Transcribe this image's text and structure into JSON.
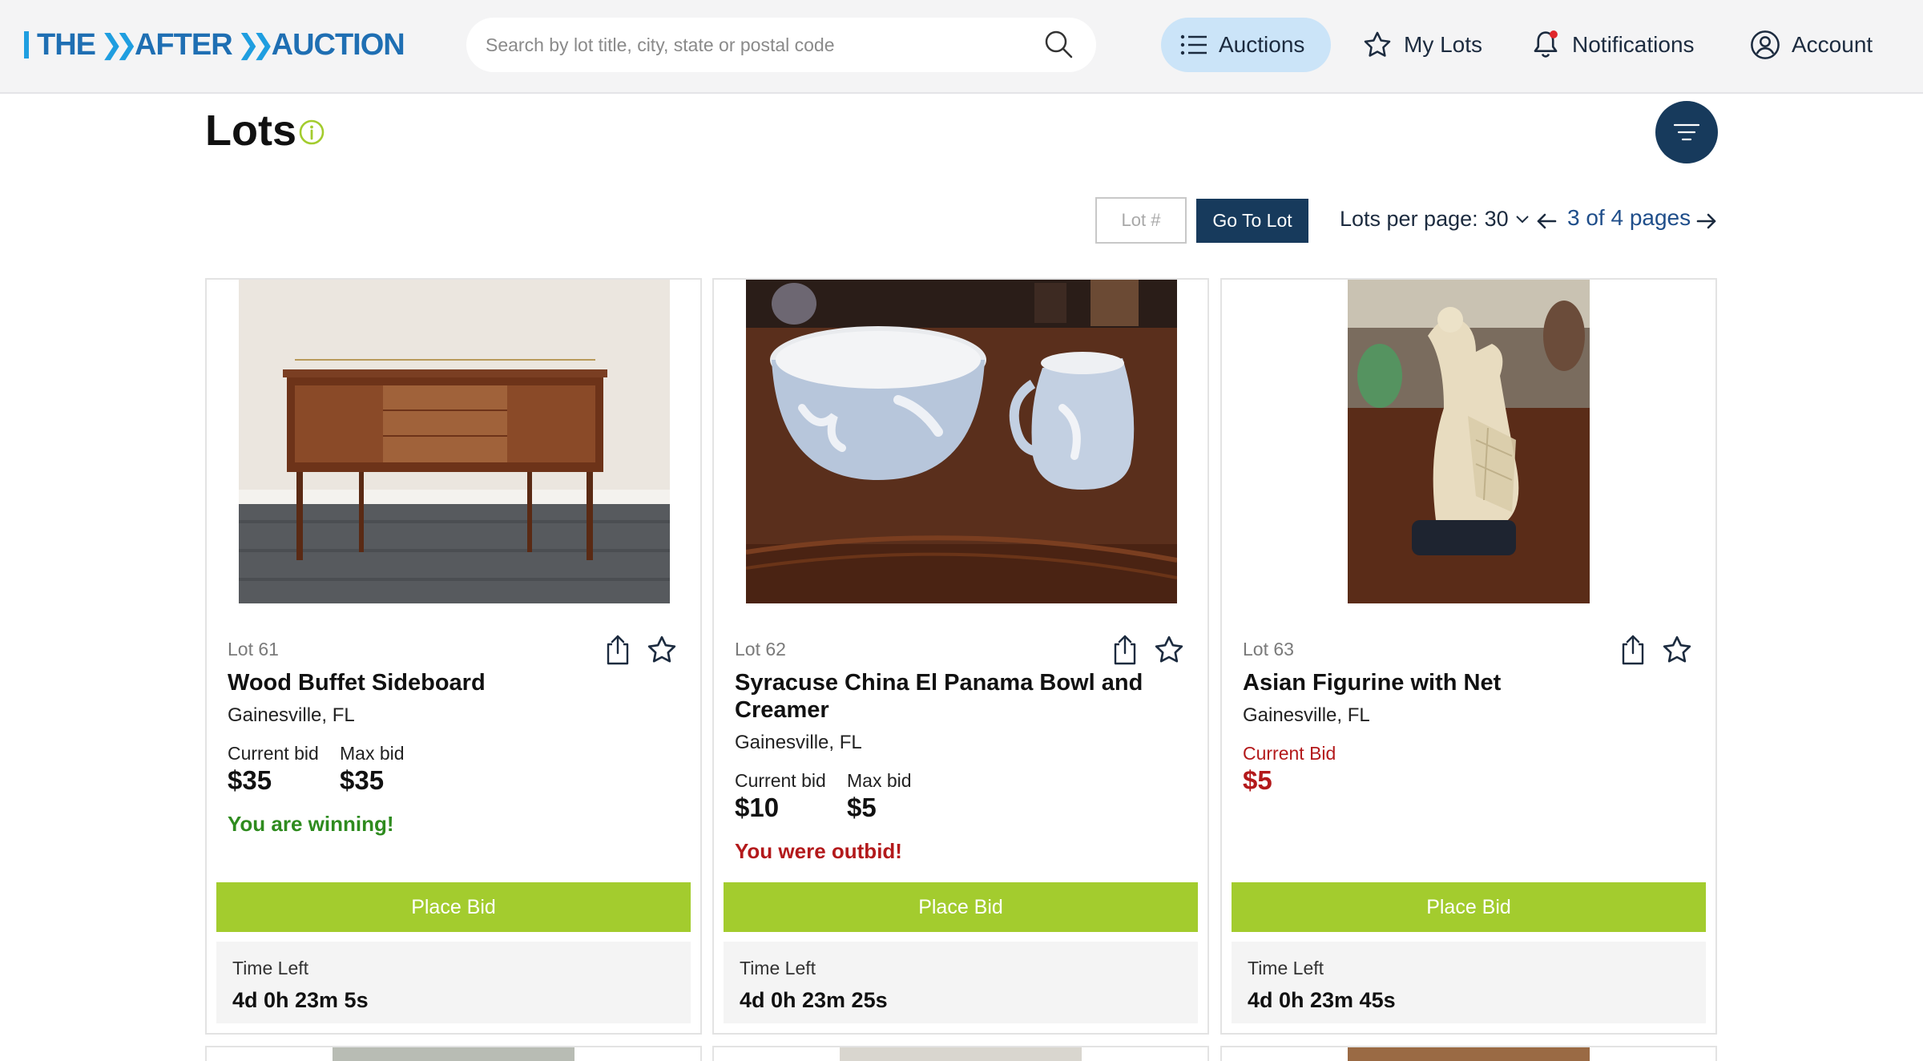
{
  "header": {
    "logo": {
      "part1": "THE",
      "part2": "AFTER",
      "part3": "AUCTION"
    },
    "search": {
      "placeholder": "Search by lot title, city, state or postal code",
      "value": ""
    },
    "nav": {
      "auctions": "Auctions",
      "my_lots": "My Lots",
      "notifications": "Notifications",
      "account": "Account"
    }
  },
  "page": {
    "title": "Lots"
  },
  "controls": {
    "lot_placeholder": "Lot #",
    "goto_label": "Go To Lot",
    "per_page_label": "Lots per page:",
    "per_page_value": "30",
    "pagination": "3 of 4 pages"
  },
  "lots": [
    {
      "lot": "Lot 61",
      "title": "Wood Buffet Sideboard",
      "location": "Gainesville, FL",
      "current_bid_label": "Current bid",
      "current_bid": "$35",
      "max_bid_label": "Max bid",
      "max_bid": "$35",
      "status": "You are winning!",
      "place_bid": "Place Bid",
      "time_left_label": "Time Left",
      "time_left": "4d 0h 23m 5s"
    },
    {
      "lot": "Lot 62",
      "title": "Syracuse China El Panama Bowl and Creamer",
      "location": "Gainesville, FL",
      "current_bid_label": "Current bid",
      "current_bid": "$10",
      "max_bid_label": "Max bid",
      "max_bid": "$5",
      "status": "You were outbid!",
      "place_bid": "Place Bid",
      "time_left_label": "Time Left",
      "time_left": "4d 0h 23m 25s"
    },
    {
      "lot": "Lot 63",
      "title": "Asian Figurine with Net",
      "location": "Gainesville, FL",
      "current_bid_label": "Current Bid",
      "current_bid": "$5",
      "place_bid": "Place Bid",
      "time_left_label": "Time Left",
      "time_left": "4d 0h 23m 45s"
    }
  ],
  "colors": {
    "brand_navy": "#173a5c",
    "brand_blue": "#1f9ee0",
    "bid_green": "#a3cc2e",
    "winning_green": "#2e8b1e",
    "outbid_red": "#b3191b",
    "nav_active_bg": "#cbe4f8"
  },
  "icons": {
    "search": "search-icon",
    "auctions": "list-icon",
    "my_lots": "star-icon",
    "notifications": "bell-icon",
    "account": "user-circle-icon",
    "info": "info-icon",
    "filter": "filter-icon",
    "share": "share-icon",
    "favorite": "star-icon"
  }
}
